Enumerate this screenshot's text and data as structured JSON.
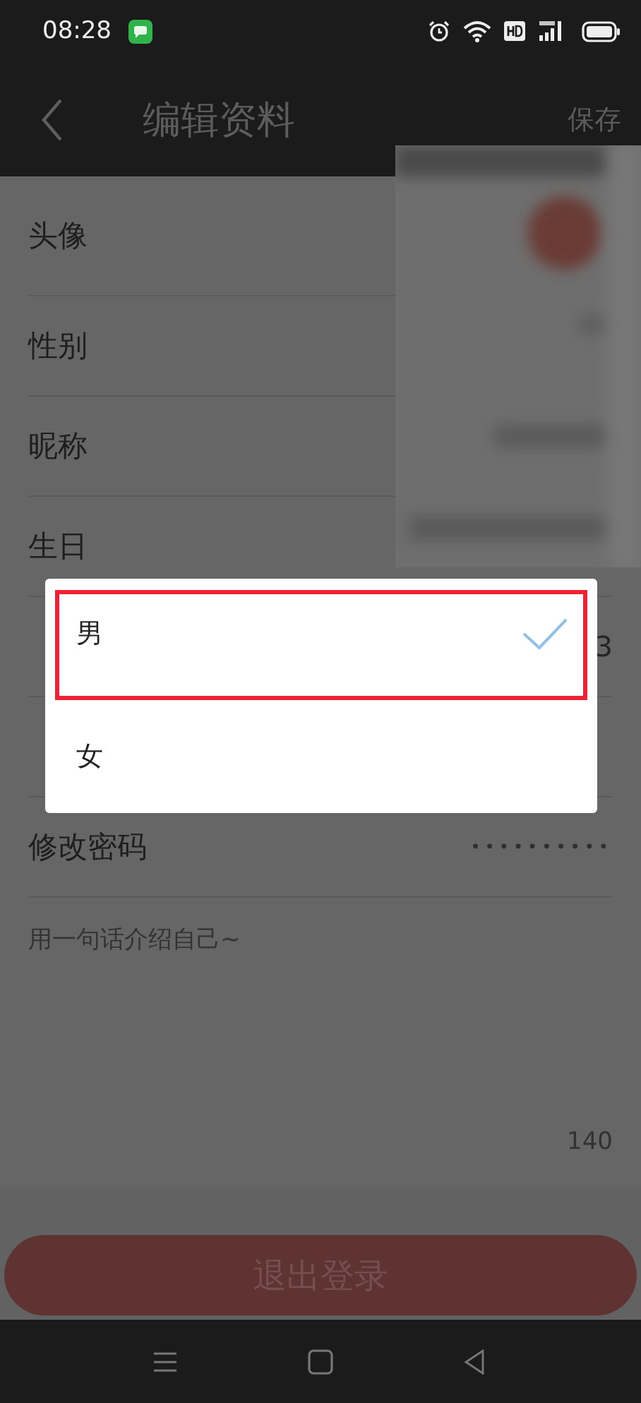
{
  "status_bar": {
    "time": "08:28"
  },
  "header": {
    "title": "编辑资料",
    "action": "保存"
  },
  "fields": [
    {
      "label": "头像",
      "kind": "avatar"
    },
    {
      "label": "性别",
      "kind": "row"
    },
    {
      "label": "昵称",
      "kind": "row"
    },
    {
      "label": "生日",
      "kind": "row"
    },
    {
      "value": "3",
      "kind": "row"
    },
    {
      "kind": "row"
    },
    {
      "label": "修改密码",
      "value": "••••••••••",
      "kind": "password"
    }
  ],
  "bio": {
    "placeholder": "用一句话介绍自己~",
    "counter": "140"
  },
  "logout_button": "退出登录",
  "dialog": {
    "options": [
      {
        "label": "男",
        "selected": true,
        "annotated": true
      },
      {
        "label": "女",
        "selected": false,
        "annotated": false
      }
    ]
  }
}
